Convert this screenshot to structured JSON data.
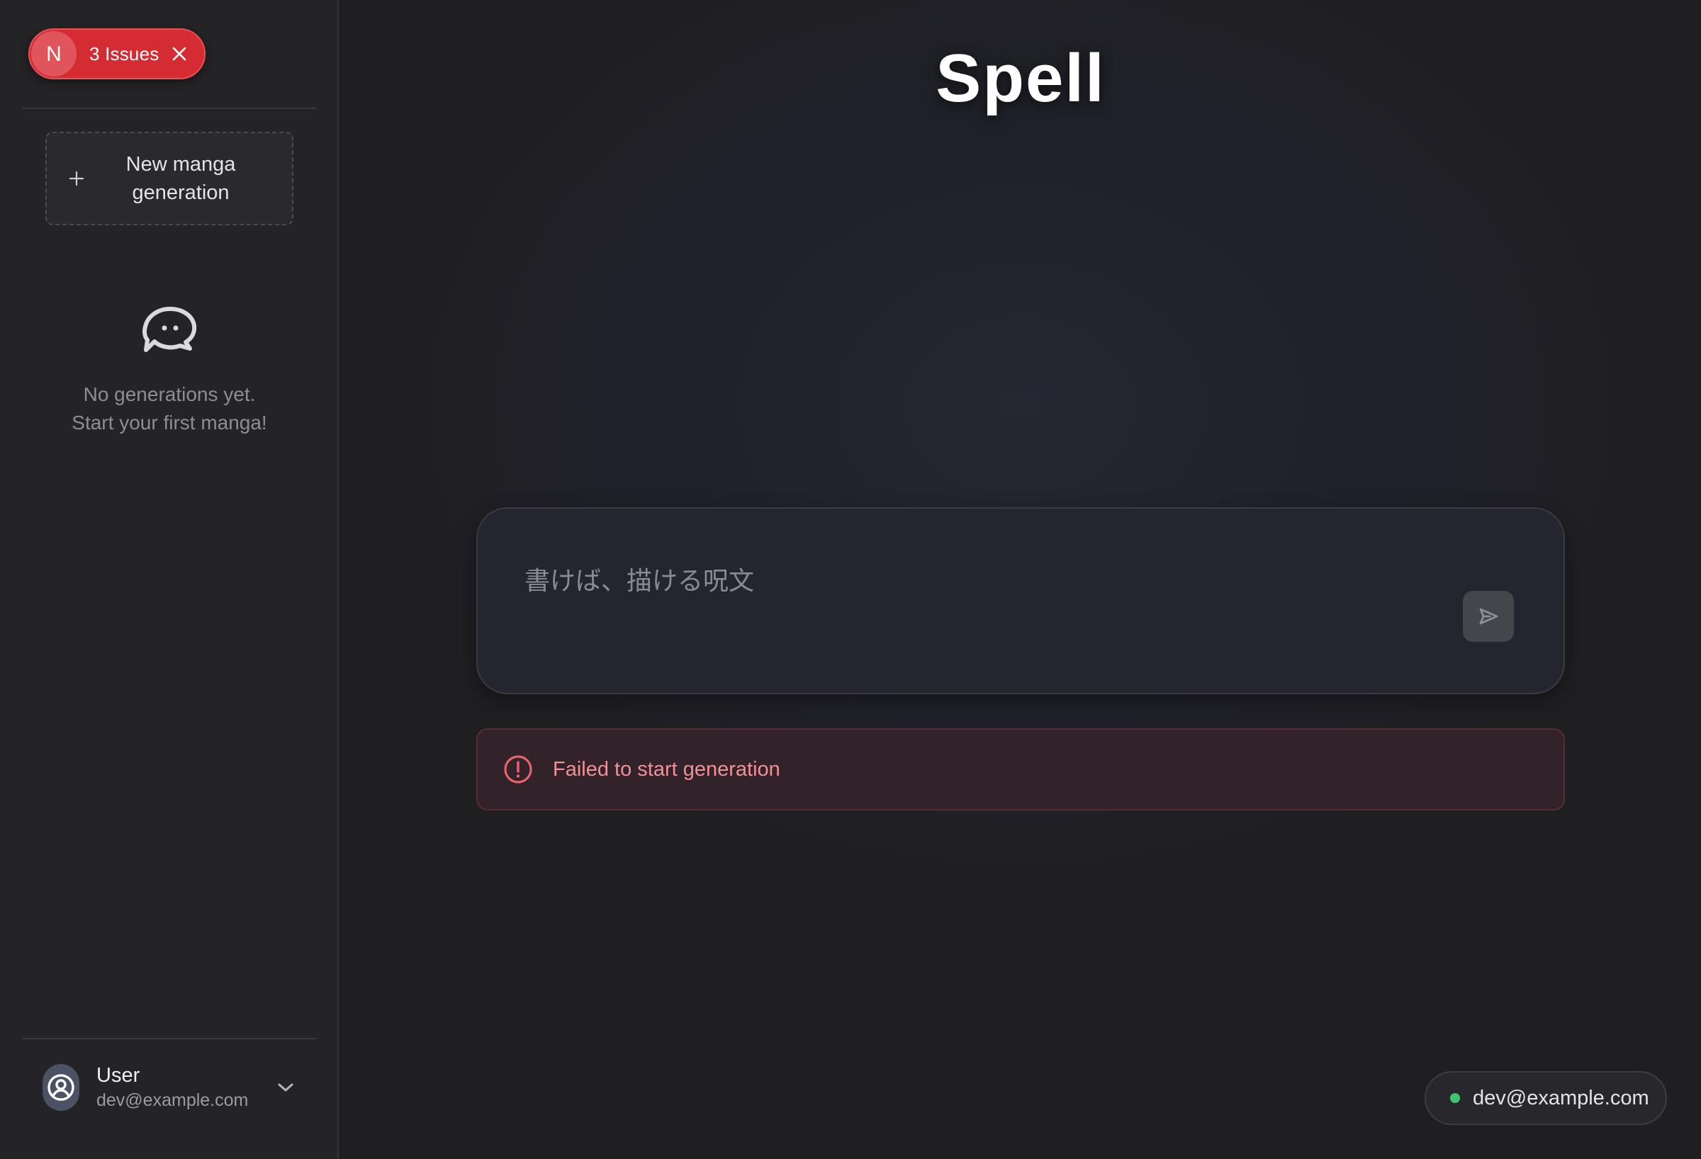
{
  "sidebar": {
    "issues_badge": {
      "letter": "N",
      "label": "3 Issues",
      "color": "#d52b33"
    },
    "new_generation_button": {
      "label": "New manga generation",
      "icon": "plus-icon"
    },
    "empty_state": {
      "icon": "chat-bubble-icon",
      "line1": "No generations yet.",
      "line2": "Start your first manga!"
    },
    "user": {
      "name": "User",
      "email": "dev@example.com",
      "avatar_icon": "user-circle-icon",
      "menu_icon": "chevron-down-icon"
    }
  },
  "main": {
    "title": "Spell",
    "prompt": {
      "placeholder": "書けば、描ける呪文",
      "value": "",
      "send_icon": "send-icon"
    },
    "error": {
      "icon": "alert-circle-icon",
      "message": "Failed to start generation",
      "color": "#f19197"
    },
    "status_chip": {
      "email": "dev@example.com",
      "status_color": "#3ec46d"
    }
  }
}
